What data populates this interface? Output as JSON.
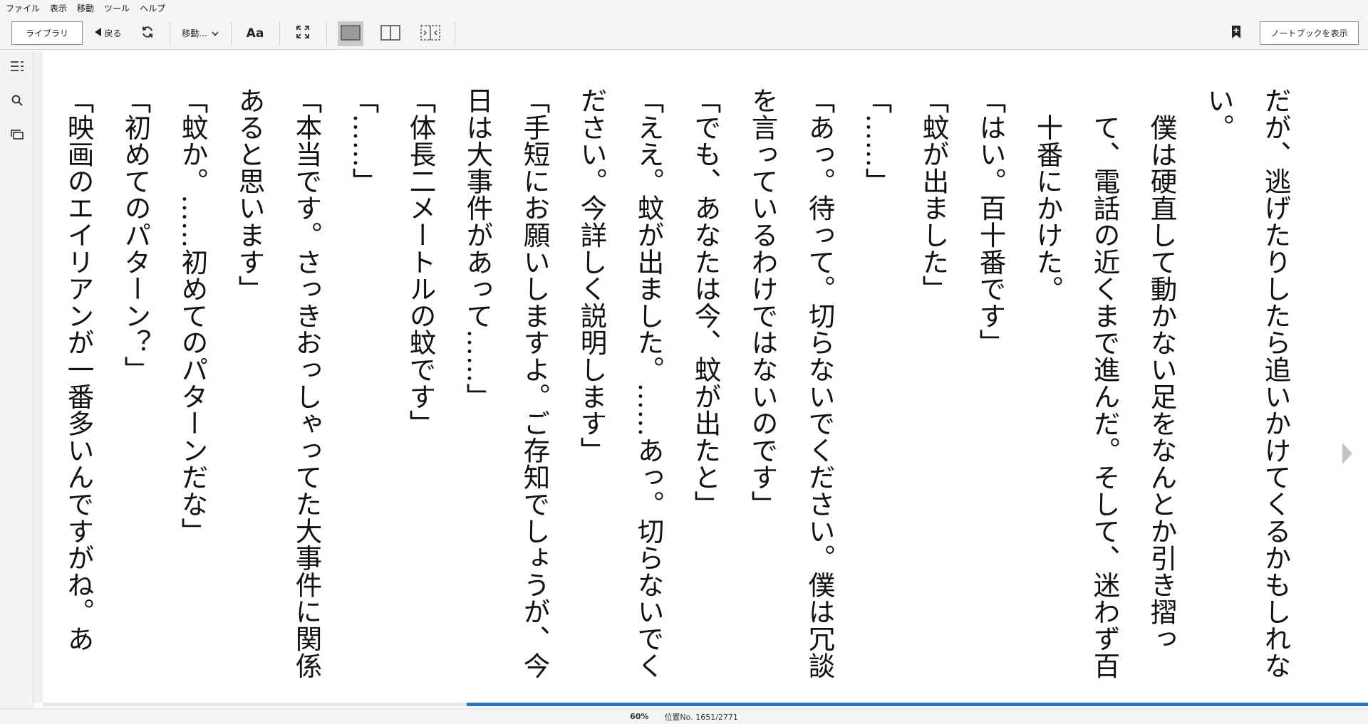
{
  "menu": [
    "ファイル",
    "表示",
    "移動",
    "ツール",
    "ヘルプ"
  ],
  "toolbar": {
    "library_label": "ライブラリ",
    "back_label": "戻る",
    "goto_label": "移動...",
    "font_label": "Aa",
    "notebook_label": "ノートブックを表示"
  },
  "icons": {
    "back": "triangle-left-icon",
    "refresh": "refresh-icon",
    "goto": "chevron-down-icon",
    "fullscreen": "fullscreen-icon",
    "single_page": "single-page-icon",
    "double_page": "two-page-icon",
    "fit": "fit-width-icon",
    "bookmark": "bookmark-add-icon",
    "toc": "table-of-contents-icon",
    "search": "search-icon",
    "flashcards": "flashcards-icon",
    "next": "next-page-arrow-icon"
  },
  "colors": {
    "progress": "#2a75c3",
    "active_view_bg": "#c9c9c9"
  },
  "content": {
    "lines": [
      "だが、逃げたりしたら追いかけてくるかもしれない。",
      "僕は硬直して動かない足をなんとか引き摺って、電話の近くまで進んだ。そして、迷わず百十番にかけた。",
      "「はい。百十番です」",
      "「蚊が出ました」",
      "「……」",
      "「あっ。待って。切らないでください。僕は冗談を言っているわけではないのです」",
      "「でも、あなたは今、蚊が出たと」",
      "「ええ。蚊が出ました。……あっ。切らないでください。今詳しく説明します」",
      "「手短にお願いしますよ。ご存知でしょうが、今日は大事件があって……」",
      "「体長二メートルの蚊です」",
      "「……」",
      "「本当です。さっきおっしゃってた大事件に関係あると思います」",
      "「蚊か。……初めてのパターンだな」",
      "「初めてのパターン？」",
      "「映画のエイリアンが一番多いんですがね。あ"
    ]
  },
  "status": {
    "percent": "60%",
    "location": "位置No. 1651/2771",
    "progress_fraction": 0.6
  }
}
